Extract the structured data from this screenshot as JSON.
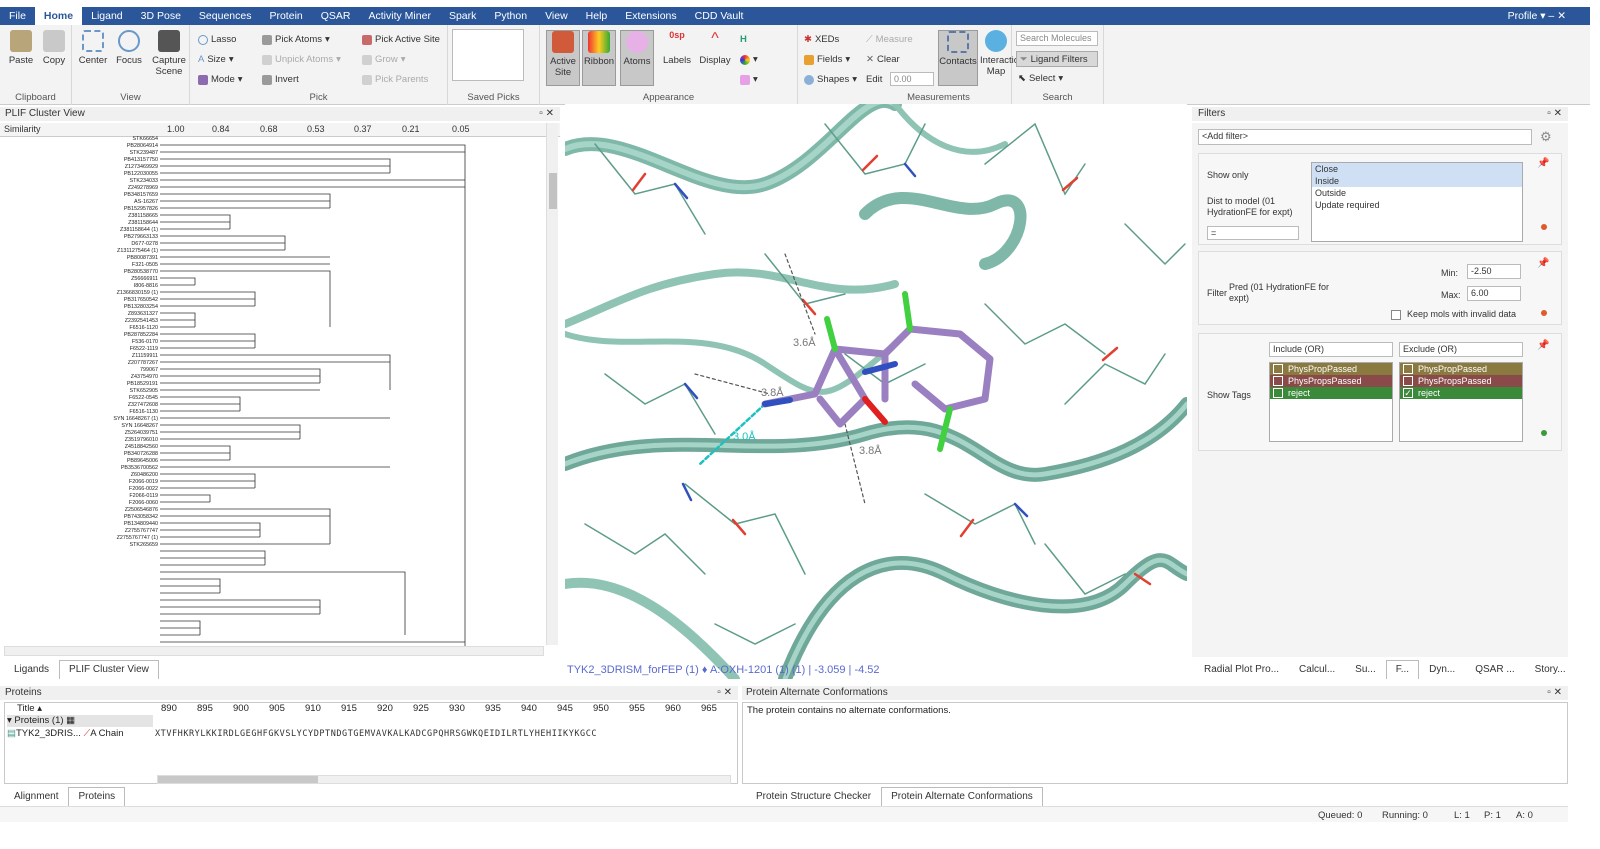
{
  "menubar": {
    "items": [
      "File",
      "Home",
      "Ligand",
      "3D Pose",
      "Sequences",
      "Protein",
      "QSAR",
      "Activity Miner",
      "Spark",
      "Python",
      "View",
      "Help",
      "Extensions",
      "CDD Vault"
    ],
    "profile": "Profile"
  },
  "ribbon": {
    "clipboard": {
      "label": "Clipboard",
      "paste": "Paste",
      "copy": "Copy"
    },
    "view": {
      "label": "View",
      "center": "Center",
      "focus": "Focus",
      "capture": "Capture Scene"
    },
    "pick": {
      "label": "Pick",
      "lasso": "Lasso",
      "size": "Size",
      "mode": "Mode",
      "pick_atoms": "Pick Atoms",
      "unpick_atoms": "Unpick Atoms",
      "invert": "Invert",
      "pick_active_site": "Pick Active Site",
      "grow": "Grow",
      "pick_parents": "Pick Parents"
    },
    "saved_picks": {
      "label": "Saved Picks"
    },
    "appearance": {
      "label": "Appearance",
      "active_site": "Active Site",
      "ribbon": "Ribbon",
      "atoms": "Atoms",
      "labels": "Labels",
      "display": "Display"
    },
    "xeds": {
      "xeds": "XEDs",
      "fields": "Fields",
      "shapes": "Shapes"
    },
    "measurements": {
      "label": "Measurements",
      "measure": "Measure",
      "clear": "Clear",
      "edit": "Edit",
      "edit_value": "0.00",
      "contacts": "Contacts",
      "interaction_map": "Interaction Map"
    },
    "search": {
      "label": "Search",
      "placeholder": "Search Molecules",
      "ligand_filters": "Ligand Filters",
      "select": "Select"
    }
  },
  "plif": {
    "title": "PLIF Cluster View",
    "similarity_label": "Similarity",
    "ticks": [
      "1.00",
      "0.84",
      "0.68",
      "0.53",
      "0.37",
      "0.21",
      "0.05"
    ],
    "leaves": [
      "STK66654",
      "PB28064914",
      "STK239487",
      "PB413157750",
      "Z1273469929",
      "PB122030055",
      "STK234033",
      "Z249278969",
      "PB348157659",
      "AS-16267",
      "PB152957826",
      "Z381158665",
      "Z381158644",
      "Z381158644 (1)",
      "PB279663133",
      "D677-0278",
      "Z1311275464 (1)",
      "PB80087391",
      "F321-0505",
      "PB280538770",
      "Z56666911",
      "I806-8816",
      "Z1366830159 (1)",
      "PB317650542",
      "PB132803254",
      "Z893631327",
      "Z2392541453",
      "F6516-1120",
      "PB287852284",
      "F536-0170",
      "F6522-1119",
      "Z11159911",
      "Z207787267",
      "799067",
      "Z43754970",
      "PB18529191",
      "STK652905",
      "F6522-0545",
      "Z327472608",
      "F6516-1130",
      "SYN 16648267 (1)",
      "SYN 16648267",
      "Z5264039751",
      "Z3519796010",
      "Z4518842560",
      "PB340726288",
      "PB89645006",
      "PB3536700562",
      "Z60486200",
      "F2066-0019",
      "F2066-0022",
      "F2066-0119",
      "F2066-0060",
      "Z2506546876",
      "PB743058342",
      "PB134809440",
      "Z2755767747",
      "Z2755767747 (1)",
      "STK265659"
    ],
    "tabs": [
      "Ligands",
      "PLIF Cluster View"
    ]
  },
  "viewer": {
    "distances": [
      "3.6Å",
      "3.8Å",
      "3.0Å",
      "3.8Å"
    ],
    "caption": "TYK2_3DRISM_forFEP (1) ♦ A:OXH-1201 (1) (1) | -3.059 | -4.52"
  },
  "filters": {
    "title": "Filters",
    "add_filter": "<Add filter>",
    "show_only": "Show only",
    "dist_label": "Dist to model (01 HydrationFE for expt)",
    "dist_operator": "=",
    "show_only_options": [
      "Close",
      "Inside",
      "Outside",
      "Update required"
    ],
    "filter_label": "Filter",
    "pred_label": "Pred (01 HydrationFE for expt)",
    "min_label": "Min:",
    "min_value": "-2.50",
    "max_label": "Max:",
    "max_value": "6.00",
    "keep_invalid": "Keep mols with invalid data",
    "show_tags": "Show Tags",
    "include_label": "Include (OR)",
    "exclude_label": "Exclude (OR)",
    "tags": [
      {
        "name": "PhysPropPassed",
        "color": "#8a7a40"
      },
      {
        "name": "PhysPropsPassed",
        "color": "#8a4a4a"
      },
      {
        "name": "reject",
        "color": "#3a8a3a"
      }
    ],
    "bottom_tabs": [
      "Radial Plot Pro...",
      "Calcul...",
      "Su...",
      "F...",
      "Dyn...",
      "QSAR ...",
      "Story..."
    ]
  },
  "proteins": {
    "title": "Proteins",
    "title_col": "Title",
    "positions": [
      "890",
      "895",
      "900",
      "905",
      "910",
      "915",
      "920",
      "925",
      "930",
      "935",
      "940",
      "945",
      "950",
      "955",
      "960",
      "965"
    ],
    "group": "Proteins (1)",
    "protein_name": "TYK2_3DRIS...",
    "chain": "A Chain",
    "sequence": "XTVFHKRYLKKIRDLGEGHFGKVSLYCYDPTNDGTGEMVAVKALKADCGPQHRSGWKQEIDILRTLYHEHIIKYKGCC",
    "tabs": [
      "Alignment",
      "Proteins"
    ]
  },
  "alt_conf": {
    "title": "Protein Alternate Conformations",
    "message": "The protein contains no alternate conformations.",
    "tabs": [
      "Protein Structure Checker",
      "Protein Alternate Conformations"
    ]
  },
  "status": {
    "queued": "Queued: 0",
    "running": "Running: 0",
    "l": "L: 1",
    "p": "P: 1",
    "a": "A: 0"
  }
}
